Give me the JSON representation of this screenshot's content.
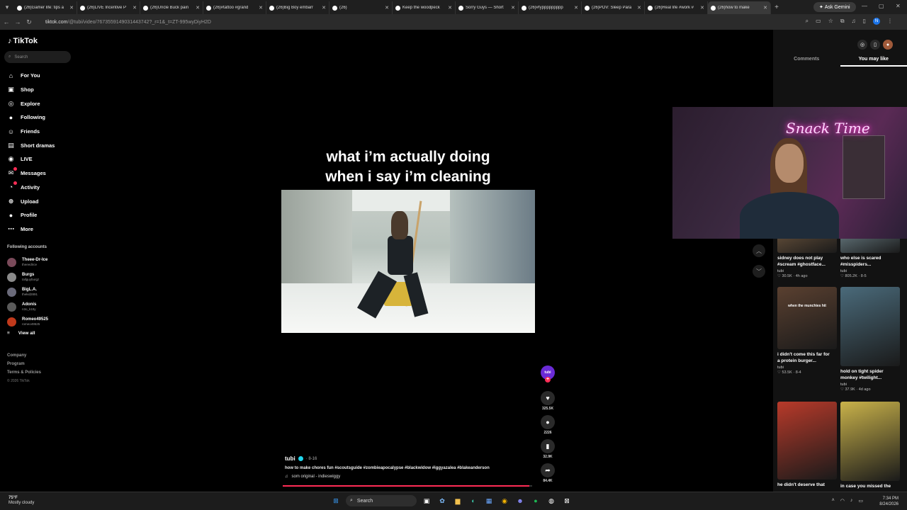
{
  "browser": {
    "tabs": [
      {
        "label": "(26)Gamer life: tips a"
      },
      {
        "label": "(26)LIVE Incentive P"
      },
      {
        "label": "(26)Uncle Buck pain"
      },
      {
        "label": "(26)#tattoo #grand"
      },
      {
        "label": "(26)Big Boy embarr"
      },
      {
        "label": "(26)"
      },
      {
        "label": "Keep the woodpeck"
      },
      {
        "label": "Sorry Guys — Short"
      },
      {
        "label": "(26)#fyppppppppp"
      },
      {
        "label": "(26)POV: Sleep Para"
      },
      {
        "label": "(26)Real life #work #"
      },
      {
        "label": "(26)how to make"
      }
    ],
    "ask_gemini": "Ask Gemini",
    "url_host": "tiktok.com",
    "url_path": "/@tubi/video/7673559149031443742?_r=1&_t=ZT-995wyDiyH2D",
    "profile_initial": "N"
  },
  "tiktok": {
    "logo": "TikTok",
    "search_placeholder": "Search",
    "nav": [
      {
        "label": "For You",
        "icon": "home-icon"
      },
      {
        "label": "Shop",
        "icon": "shop-icon"
      },
      {
        "label": "Explore",
        "icon": "compass-icon"
      },
      {
        "label": "Following",
        "icon": "following-icon"
      },
      {
        "label": "Friends",
        "icon": "friends-icon"
      },
      {
        "label": "Short dramas",
        "icon": "dramas-icon"
      },
      {
        "label": "LIVE",
        "icon": "live-icon"
      },
      {
        "label": "Messages",
        "icon": "messages-icon"
      },
      {
        "label": "Activity",
        "icon": "activity-icon"
      },
      {
        "label": "Upload",
        "icon": "upload-icon"
      },
      {
        "label": "Profile",
        "icon": "profile-icon"
      },
      {
        "label": "More",
        "icon": "more-icon"
      }
    ],
    "following_header": "Following accounts",
    "following": [
      {
        "name": "Theee-Dr-Ice",
        "handle": "theeedrice"
      },
      {
        "name": "Burgs",
        "handle": "tallguyburgz"
      },
      {
        "name": "BigL.A.",
        "handle": "thekid2891"
      },
      {
        "name": "Adonis",
        "handle": "n3o_k1tty"
      },
      {
        "name": "Romeo49525",
        "handle": "romeo49525"
      }
    ],
    "view_all": "View all",
    "footer": [
      "Company",
      "Program",
      "Terms & Policies"
    ],
    "copyright": "© 2026 TikTok"
  },
  "video": {
    "caption_line1": "what i’m actually doing",
    "caption_line2": "when i say i’m cleaning",
    "author": "tubi",
    "date": "· 8-16",
    "description": "how to make chores fun #scoutsguide #zombieapocalypse #blackwidow #iggyazalea #blakeanderson",
    "sound": "som original - indieswiggy",
    "avatar_label": "tubi",
    "likes": "325.5K",
    "comments": "2226",
    "saves": "32.9K",
    "shares": "84.4K",
    "progress_fraction": 0.99
  },
  "right_panel": {
    "tab_comments": "Comments",
    "tab_you_may_like": "You may like",
    "cards": [
      {
        "title_line1": "sidney does not play",
        "title_line2": "#scream #ghostface...",
        "author": "tubi",
        "stats": "♡ 30.5K · 4h ago",
        "thumb": "#8a6a4a"
      },
      {
        "title_line1": "who else is scared",
        "title_line2": "#misspiders...",
        "author": "tubi",
        "stats": "♡ 805.2K · 8-5",
        "thumb": "#8aa6b0"
      },
      {
        "title_line1": "i didn't come this far for",
        "title_line2": "a protein burger...",
        "author": "tubi",
        "stats": "♡ 53.5K · 8-4",
        "thumb": "#5a4030",
        "overlay": "when the munchies hit"
      },
      {
        "title_line1": "hold on tight spider",
        "title_line2": "monkey #twilight...",
        "author": "tubi",
        "stats": "♡ 37.9K · 4d ago",
        "thumb": "#4a6a7a"
      },
      {
        "title_line1": "he didn't deserve that",
        "title_line2": "",
        "author": "",
        "stats": "",
        "thumb": "#b83a2a"
      },
      {
        "title_line1": "in case you missed the",
        "title_line2": "",
        "author": "",
        "stats": "",
        "thumb": "#c9b24a"
      }
    ]
  },
  "stream_overlay": {
    "neon_sign": "Snack Time"
  },
  "taskbar": {
    "weather_temp": "75°F",
    "weather_desc": "Mostly cloudy",
    "search_label": "Search",
    "time": "7:34 PM",
    "date": "8/24/2026"
  }
}
